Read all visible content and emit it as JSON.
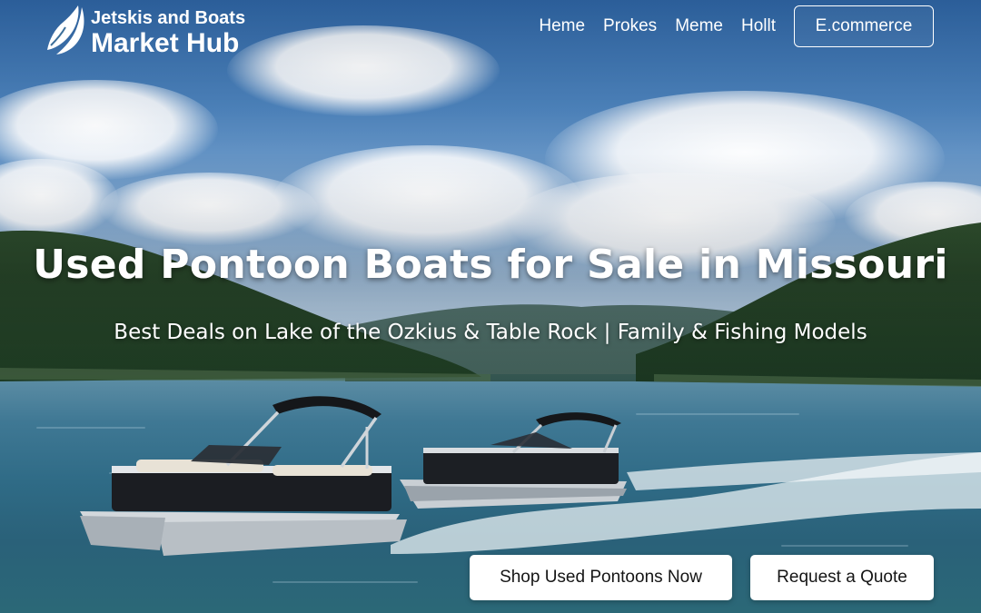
{
  "brand": {
    "name_top": "Jetskis and Boats",
    "name_bottom": "Market Hub",
    "logo_icon": "sail-leaf-icon"
  },
  "nav": {
    "links": [
      "Heme",
      "Prokes",
      "Meme",
      "Hollt"
    ],
    "button_label": "E.commerce"
  },
  "hero": {
    "title": "Used Pontoon Boats for Sale in Missouri",
    "subtitle": "Best Deals on Lake of the Ozkius & Table Rock | Family & Fishing Models"
  },
  "cta": {
    "primary_label": "Shop Used Pontoons Now",
    "secondary_label": "Request a Quote"
  },
  "colors": {
    "sky": "#4c82bb",
    "water": "#2f6b86",
    "button_bg": "#ffffff",
    "button_text": "#151515",
    "hero_text": "#ffffff"
  },
  "background_image": "pontoon-boats-on-lake-photo"
}
